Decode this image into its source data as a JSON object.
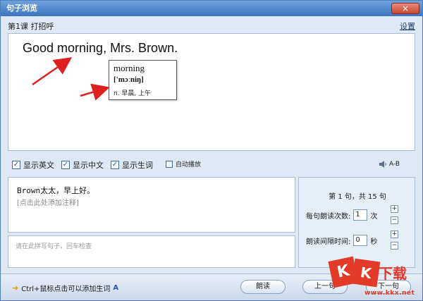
{
  "window": {
    "title": "句子浏览",
    "close_glyph": "×"
  },
  "lesson": {
    "title": "第1课 打招呼",
    "settings_label": "设置"
  },
  "sentence": {
    "english": "Good morning, Mrs. Brown."
  },
  "word_popup": {
    "word": "morning",
    "phonetic": "['mɔːniŋ]",
    "definition": "n. 早晨, 上午"
  },
  "options": {
    "show_english": {
      "label": "显示英文",
      "checked": true
    },
    "show_chinese": {
      "label": "显示中文",
      "checked": true
    },
    "show_vocab": {
      "label": "显示生词",
      "checked": true
    },
    "auto_play": {
      "label": "自动播放",
      "checked": false
    },
    "ab_label": "A-B"
  },
  "translation": {
    "text": "Brown太太，早上好。",
    "note_hint": "[点击此处添加注释]"
  },
  "write": {
    "placeholder": "请在此拼写句子，回车检查"
  },
  "controls": {
    "counter": "第 1 句，共 15 句",
    "repeat_label": "每句朗读次数:",
    "repeat_value": "1",
    "repeat_unit": "次",
    "interval_label": "朗读间隔时间:",
    "interval_value": "0",
    "interval_unit": "秒",
    "plus": "+",
    "minus": "−"
  },
  "bottom": {
    "tip": "Ctrl+鼠标点击可以添加生词",
    "tip_suffix": "A",
    "read_button": "朗读",
    "prev_button": "上一句",
    "next_button": "下一句"
  },
  "watermark": {
    "k1": "K",
    "k2": "K",
    "k3": "下载",
    "url": "www.kkx.net"
  },
  "colors": {
    "accent": "#3d74bd",
    "arrow": "#e02020",
    "watermark": "#e43a2a"
  }
}
